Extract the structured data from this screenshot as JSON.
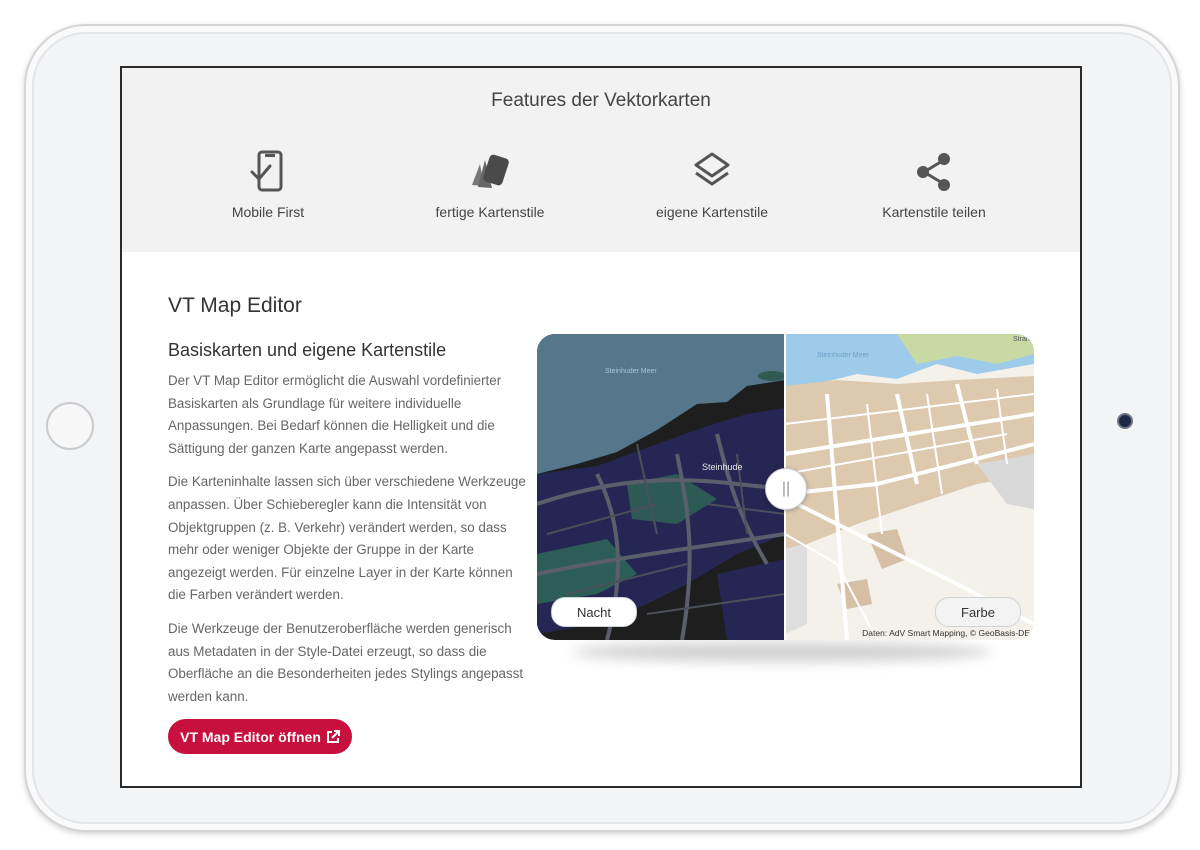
{
  "features": {
    "title": "Features der Vektorkarten",
    "items": [
      {
        "label": "Mobile First",
        "icon": "mobile-check-icon"
      },
      {
        "label": "fertige Kartenstile",
        "icon": "swatches-icon"
      },
      {
        "label": "eigene Kartenstile",
        "icon": "layers-icon"
      },
      {
        "label": "Kartenstile teilen",
        "icon": "share-icon"
      }
    ]
  },
  "editor": {
    "title": "VT Map Editor",
    "subtitle": "Basiskarten und eigene Kartenstile",
    "paragraphs": [
      "Der VT Map Editor ermöglicht die Auswahl vordefinierter Basiskarten als Grundlage für weitere individuelle Anpassungen. Bei Bedarf können die Helligkeit und die Sättigung der ganzen Karte angepasst werden.",
      "Die Karteninhalte lassen sich über verschiedene Werkzeuge anpassen. Über Schieberegler kann die Intensität von Objektgruppen (z. B. Verkehr) verändert werden, so dass mehr oder weniger Objekte der Gruppe in der Karte angezeigt werden. Für einzelne Layer in der Karte können die Farben verändert werden.",
      "Die Werkzeuge der Benutzeroberfläche werden generisch aus Metadaten in der Style-Datei erzeugt, so dass die Oberfläche an die Besonderheiten jedes Stylings angepasst werden kann."
    ],
    "button_label": "VT Map Editor öffnen"
  },
  "map": {
    "left_label": "Nacht",
    "right_label": "Farbe",
    "handle_glyph": "||",
    "attribution": "Daten: AdV Smart Mapping, © GeoBasis-DE",
    "labels": {
      "lake_dark": "Steinhuder Meer",
      "lake_light": "Steinhuder Meer",
      "town": "Steinhude",
      "edge": "Stran"
    }
  },
  "colors": {
    "accent": "#c8103e",
    "night_water": "#56768c",
    "day_water": "#9ecbea",
    "day_land": "#dcc9ae"
  }
}
